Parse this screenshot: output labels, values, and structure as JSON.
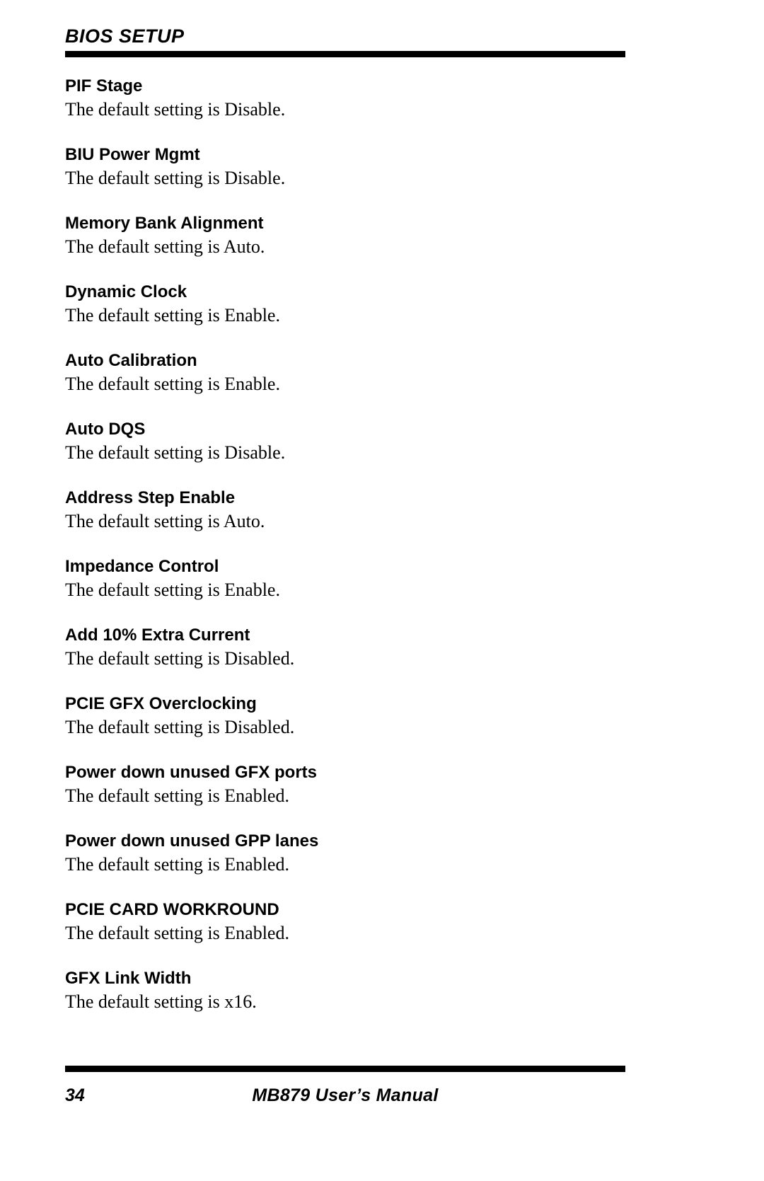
{
  "header": {
    "title": "BIOS SETUP"
  },
  "sections": [
    {
      "heading": "PIF Stage",
      "body": "The default setting is Disable."
    },
    {
      "heading": "BIU Power Mgmt",
      "body": "The default setting is Disable."
    },
    {
      "heading": "Memory Bank Alignment",
      "body": "The default setting is Auto."
    },
    {
      "heading": "Dynamic Clock",
      "body": "The default setting is Enable."
    },
    {
      "heading": "Auto Calibration",
      "body": "The default setting is Enable."
    },
    {
      "heading": "Auto DQS",
      "body": "The default setting is Disable."
    },
    {
      "heading": "Address Step Enable",
      "body": "The default setting is Auto."
    },
    {
      "heading": "Impedance Control",
      "body": "The default setting is Enable."
    },
    {
      "heading": "Add 10% Extra Current",
      "body": "The default setting is Disabled."
    },
    {
      "heading": "PCIE GFX Overclocking",
      "body": "The default setting is Disabled."
    },
    {
      "heading": "Power down unused GFX ports",
      "body": "The default setting is Enabled."
    },
    {
      "heading": "Power down unused GPP lanes",
      "body": "The default setting is Enabled."
    },
    {
      "heading": "PCIE CARD WORKROUND",
      "body": "The default setting is Enabled."
    },
    {
      "heading": "GFX Link Width",
      "body": "The default setting is x16."
    }
  ],
  "footer": {
    "page_number": "34",
    "manual_title": "MB879 User’s Manual"
  }
}
